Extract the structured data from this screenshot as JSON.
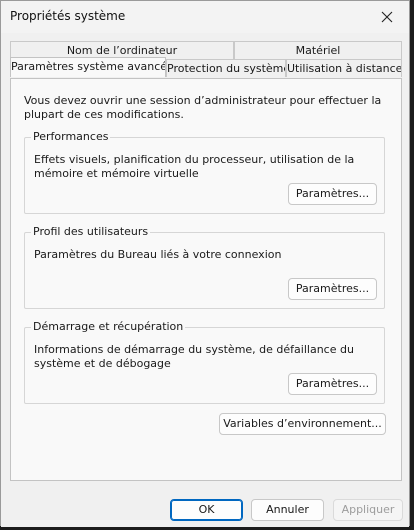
{
  "window": {
    "title": "Propriétés système",
    "close_icon": "close-icon"
  },
  "tabs": {
    "row1": [
      {
        "label": "Nom de l’ordinateur"
      },
      {
        "label": "Matériel"
      }
    ],
    "row2": [
      {
        "label": "Paramètres système avancés",
        "active": true
      },
      {
        "label": "Protection du système"
      },
      {
        "label": "Utilisation à distance"
      }
    ]
  },
  "intro": "Vous devez ouvrir une session d’administrateur pour effectuer la plupart de ces modifications.",
  "groups": [
    {
      "legend": "Performances",
      "description": "Effets visuels, planification du processeur, utilisation de la mémoire et mémoire virtuelle",
      "button": "Paramètres..."
    },
    {
      "legend": "Profil des utilisateurs",
      "description": "Paramètres du Bureau liés à votre connexion",
      "button": "Paramètres..."
    },
    {
      "legend": "Démarrage et récupération",
      "description": "Informations de démarrage du système, de défaillance du système et de débogage",
      "button": "Paramètres..."
    }
  ],
  "env_button": "Variables d’environnement...",
  "footer": {
    "ok": "OK",
    "cancel": "Annuler",
    "apply": "Appliquer"
  }
}
